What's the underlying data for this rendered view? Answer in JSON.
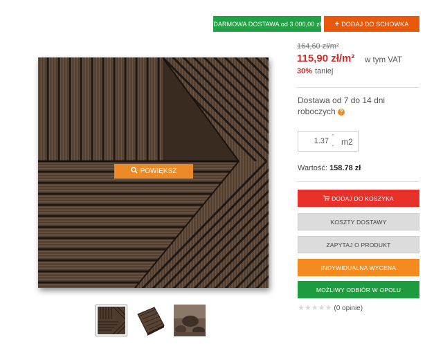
{
  "header": {
    "free_shipping": "DARMOWA DOSTAWA od 3 000,00 zł",
    "add_to_favorites": "DODAJ DO SCHOWKA",
    "add_to_favorites_icon": "plus-icon"
  },
  "gallery": {
    "zoom_label": "POWIĘKSZ",
    "zoom_icon": "magnifier-icon",
    "thumbnail_count": 3
  },
  "price": {
    "old": "164,60 zł/m²",
    "current": "115,90 zł/m²",
    "vat_note": "w tym VAT",
    "discount_percent": "30%",
    "discount_word": "taniej"
  },
  "delivery": {
    "text": "Dostawa od 7 do 14 dni roboczych",
    "help_icon": "question-icon"
  },
  "quantity": {
    "value": "1.37",
    "unit": "m2"
  },
  "total": {
    "label": "Wartość:",
    "amount": "158.78 zł"
  },
  "actions": {
    "add_to_cart": "DODAJ DO KOSZYKA",
    "add_to_cart_icon": "cart-icon",
    "shipping_cost": "KOSZTY DOSTAWY",
    "ask_product": "ZAPYTAJ O PRODUKT",
    "individual_quote": "INDYWIDUALNA WYCENA",
    "pickup": "MOŻLIWY ODBIÓR W OPOLU"
  },
  "rating": {
    "stars_filled": 0,
    "stars_total": 5,
    "count_text": "(0 opinie)"
  },
  "colors": {
    "green": "#22a244",
    "orange": "#e8590c",
    "red": "#e8312a",
    "price_red": "#d42a2a",
    "tile_brown": "#5a4637"
  }
}
